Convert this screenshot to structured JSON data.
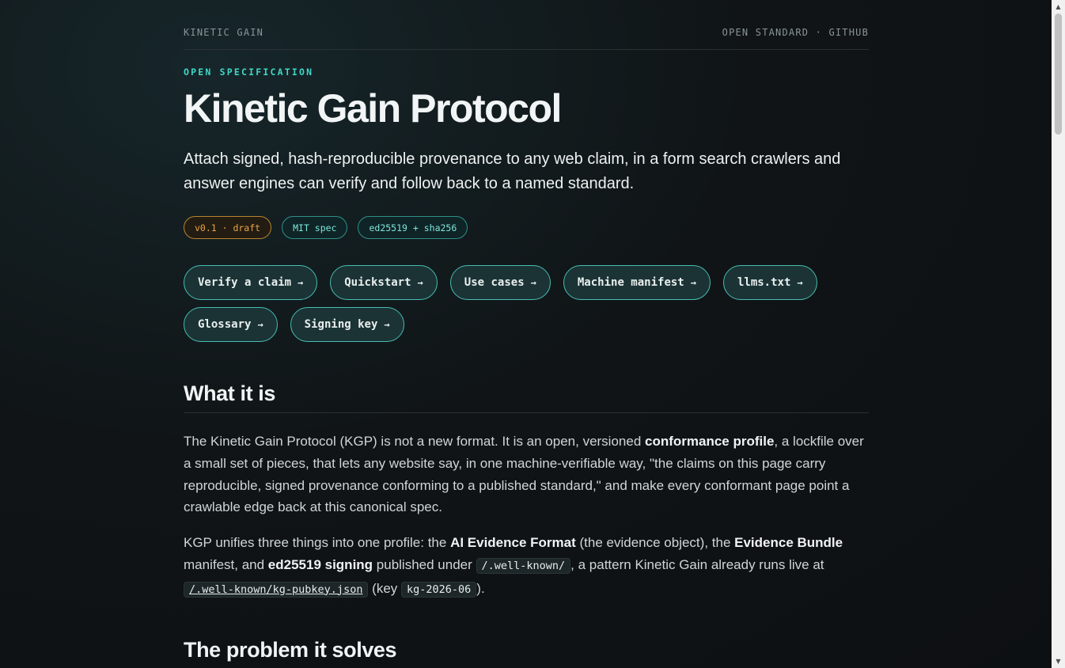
{
  "topbar": {
    "brand": "KINETIC GAIN",
    "links": "OPEN STANDARD · GITHUB"
  },
  "hero": {
    "eyebrow": "OPEN SPECIFICATION",
    "title": "Kinetic Gain Protocol",
    "lede": "Attach signed, hash-reproducible provenance to any web claim, in a form search crawlers and answer engines can verify and follow back to a named standard."
  },
  "badges": [
    "v0.1 · draft",
    "MIT spec",
    "ed25519 + sha256"
  ],
  "actions": [
    "Verify a claim",
    "Quickstart",
    "Use cases",
    "Machine manifest",
    "llms.txt",
    "Glossary",
    "Signing key"
  ],
  "arrow_glyph": "→",
  "what_it_is": {
    "heading": "What it is",
    "p1_a": "The Kinetic Gain Protocol (KGP) is not a new format. It is an open, versioned ",
    "p1_b": "conformance profile",
    "p1_c": ", a lockfile over a small set of pieces, that lets any website say, in one machine-verifiable way, \"the claims on this page carry reproducible, signed provenance conforming to a published standard,\" and make every conformant page point a crawlable edge back at this canonical spec.",
    "p2_a": "KGP unifies three things into one profile: the ",
    "p2_b": "AI Evidence Format",
    "p2_c": " (the evidence object), the ",
    "p2_d": "Evidence Bundle",
    "p2_e": " manifest, and ",
    "p2_f": "ed25519 signing",
    "p2_g": " published under ",
    "p2_code1": "/.well-known/",
    "p2_h": ", a pattern Kinetic Gain already runs live at ",
    "p2_code2": "/.well-known/kg-pubkey.json",
    "p2_i": " (key ",
    "p2_code3": "kg-2026-06",
    "p2_j": ")."
  },
  "problem": {
    "heading": "The problem it solves"
  }
}
